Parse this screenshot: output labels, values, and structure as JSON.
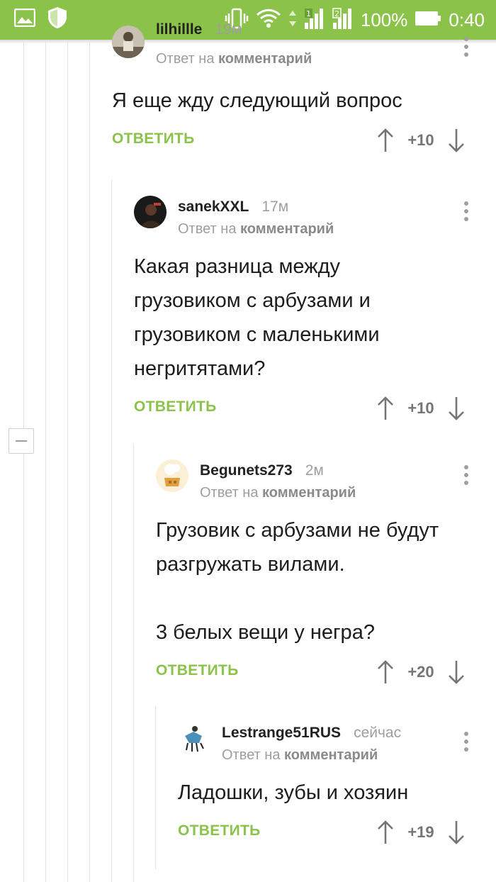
{
  "status_bar": {
    "battery": "100%",
    "time": "0:40",
    "sim2_label": "2"
  },
  "comments": [
    {
      "author": "lilhillle",
      "time_ago": "19м",
      "reply_prefix": "Ответ на",
      "reply_target": "комментарий",
      "text": "Я еще жду следующий вопрос",
      "reply_label": "ОТВЕТИТЬ",
      "score": "+10"
    },
    {
      "author": "sanekXXL",
      "time_ago": "17м",
      "reply_prefix": "Ответ на",
      "reply_target": "комментарий",
      "text": "Какая разница между\nгрузовиком с арбузами и\nгрузовиком с маленькими\nнегритятами?",
      "reply_label": "ОТВЕТИТЬ",
      "score": "+10"
    },
    {
      "author": "Begunets273",
      "time_ago": "2м",
      "reply_prefix": "Ответ на",
      "reply_target": "комментарий",
      "text": "Грузовик с арбузами не будут\nразгружать вилами.\n\n3 белых вещи у негра?",
      "reply_label": "ОТВЕТИТЬ",
      "score": "+20"
    },
    {
      "author": "Lestrange51RUS",
      "time_ago": "сейчас",
      "reply_prefix": "Ответ на",
      "reply_target": "комментарий",
      "text": "Ладошки, зубы и хозяин",
      "reply_label": "ОТВЕТИТЬ",
      "score": "+19"
    }
  ],
  "colors": {
    "accent": "#8bc34a",
    "muted": "#9e9e9e",
    "text": "#1d1d1d"
  }
}
